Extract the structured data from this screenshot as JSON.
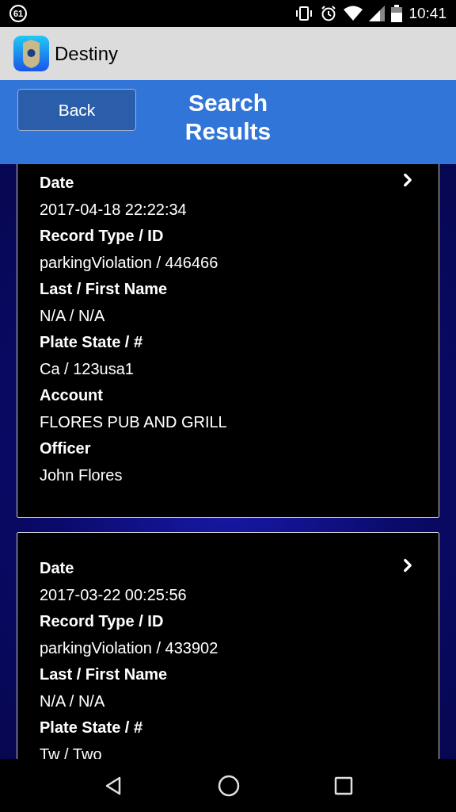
{
  "status_bar": {
    "notification_count": "61",
    "time": "10:41"
  },
  "app_bar": {
    "title": "Destiny"
  },
  "header": {
    "back_button": "Back",
    "title": "Search Results"
  },
  "results": [
    {
      "fields": [
        {
          "label": "Date",
          "value": "2017-04-18 22:22:34"
        },
        {
          "label": "Record Type / ID",
          "value": "parkingViolation / 446466"
        },
        {
          "label": "Last / First Name",
          "value": "N/A / N/A"
        },
        {
          "label": "Plate State / #",
          "value": "Ca / 123usa1"
        },
        {
          "label": "Account",
          "value": "FLORES PUB AND GRILL"
        },
        {
          "label": "Officer",
          "value": "John Flores"
        }
      ]
    },
    {
      "fields": [
        {
          "label": "Date",
          "value": "2017-03-22 00:25:56"
        },
        {
          "label": "Record Type / ID",
          "value": "parkingViolation / 433902"
        },
        {
          "label": "Last / First Name",
          "value": "N/A / N/A"
        },
        {
          "label": "Plate State / #",
          "value": "Tw / Two"
        }
      ]
    }
  ]
}
